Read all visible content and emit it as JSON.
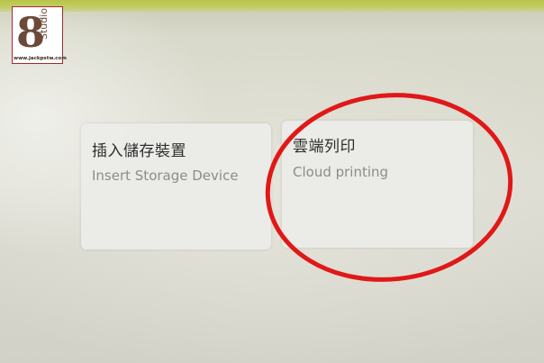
{
  "watermark": {
    "letter": "8",
    "studio_text": "Studio",
    "url": "www.jackpstw.com"
  },
  "options": [
    {
      "title": "插入儲存裝置",
      "subtitle": "Insert Storage Device"
    },
    {
      "title": "雲端列印",
      "subtitle": "Cloud printing"
    }
  ],
  "colors": {
    "top_bar": "#b8c447",
    "card_bg": "#ecebe8",
    "title_text": "#2e2e2e",
    "subtitle_text": "#8c8c8c",
    "highlight_ring": "#e01818"
  }
}
